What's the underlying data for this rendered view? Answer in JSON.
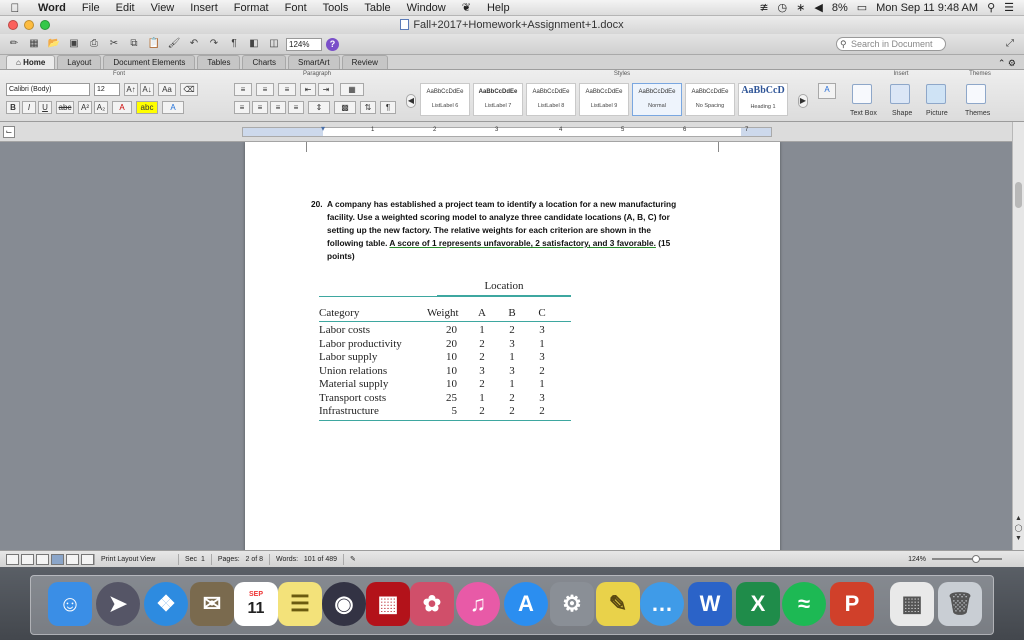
{
  "menubar": {
    "app": "Word",
    "items": [
      "File",
      "Edit",
      "View",
      "Insert",
      "Format",
      "Font",
      "Tools",
      "Table",
      "Window",
      "Help"
    ],
    "battery": "8%",
    "clock": "Mon Sep 11  9:48 AM"
  },
  "window": {
    "title": "Fall+2017+Homework+Assignment+1.docx"
  },
  "toolbar": {
    "zoom": "124%",
    "search_placeholder": "Search in Document"
  },
  "ribbon": {
    "tabs": [
      "Home",
      "Layout",
      "Document Elements",
      "Tables",
      "Charts",
      "SmartArt",
      "Review"
    ],
    "active_tab": "Home",
    "groups": {
      "font": "Font",
      "paragraph": "Paragraph",
      "styles": "Styles",
      "insert": "Insert",
      "themes": "Themes"
    },
    "font_name": "Calibri (Body)",
    "font_size": "12",
    "styles": [
      {
        "sample": "AaBbCcDdEe",
        "name": "ListLabel 6"
      },
      {
        "sample": "AaBbCcDdEe",
        "name": "ListLabel 7"
      },
      {
        "sample": "AaBbCcDdEe",
        "name": "ListLabel 8"
      },
      {
        "sample": "AaBbCcDdEe",
        "name": "ListLabel 9"
      },
      {
        "sample": "AaBbCcDdEe",
        "name": "Normal"
      },
      {
        "sample": "AaBbCcDdEe",
        "name": "No Spacing"
      },
      {
        "sample": "AaBbCcD",
        "name": "Heading 1"
      }
    ],
    "insert_items": [
      "Text Box",
      "Shape",
      "Picture",
      "Themes"
    ]
  },
  "ruler": {
    "numbers": [
      "1",
      "2",
      "3",
      "4",
      "5",
      "6",
      "7"
    ]
  },
  "document": {
    "question_number": "20.",
    "question_lines": [
      "A company has established a project team to identify a location for a new manufacturing",
      "facility. Use a weighted scoring model to analyze three candidate locations (A, B, C) for",
      "setting up the new factory. The relative weights for each criterion are shown in the",
      "following table."
    ],
    "question_underlined": "A score of 1 represents unfavorable, 2 satisfactory, and 3 favorable.",
    "question_points_inline": " (15",
    "question_points_end": "points)",
    "table": {
      "caption": "Location",
      "headers": [
        "Category",
        "Weight",
        "A",
        "B",
        "C"
      ],
      "rows": [
        [
          "Labor costs",
          "20",
          "1",
          "2",
          "3"
        ],
        [
          "Labor productivity",
          "20",
          "2",
          "3",
          "1"
        ],
        [
          "Labor supply",
          "10",
          "2",
          "1",
          "3"
        ],
        [
          "Union relations",
          "10",
          "3",
          "3",
          "2"
        ],
        [
          "Material supply",
          "10",
          "2",
          "1",
          "1"
        ],
        [
          "Transport costs",
          "25",
          "1",
          "2",
          "3"
        ],
        [
          "Infrastructure",
          "5",
          "2",
          "2",
          "2"
        ]
      ]
    }
  },
  "statusbar": {
    "view": "Print Layout View",
    "section_label": "Sec",
    "section_value": "1",
    "pages_label": "Pages:",
    "pages_value": "2 of 8",
    "words_label": "Words:",
    "words_value": "101 of 489",
    "zoom": "124%"
  },
  "dock": {
    "calendar_day": "11",
    "calendar_month": "SEP"
  }
}
